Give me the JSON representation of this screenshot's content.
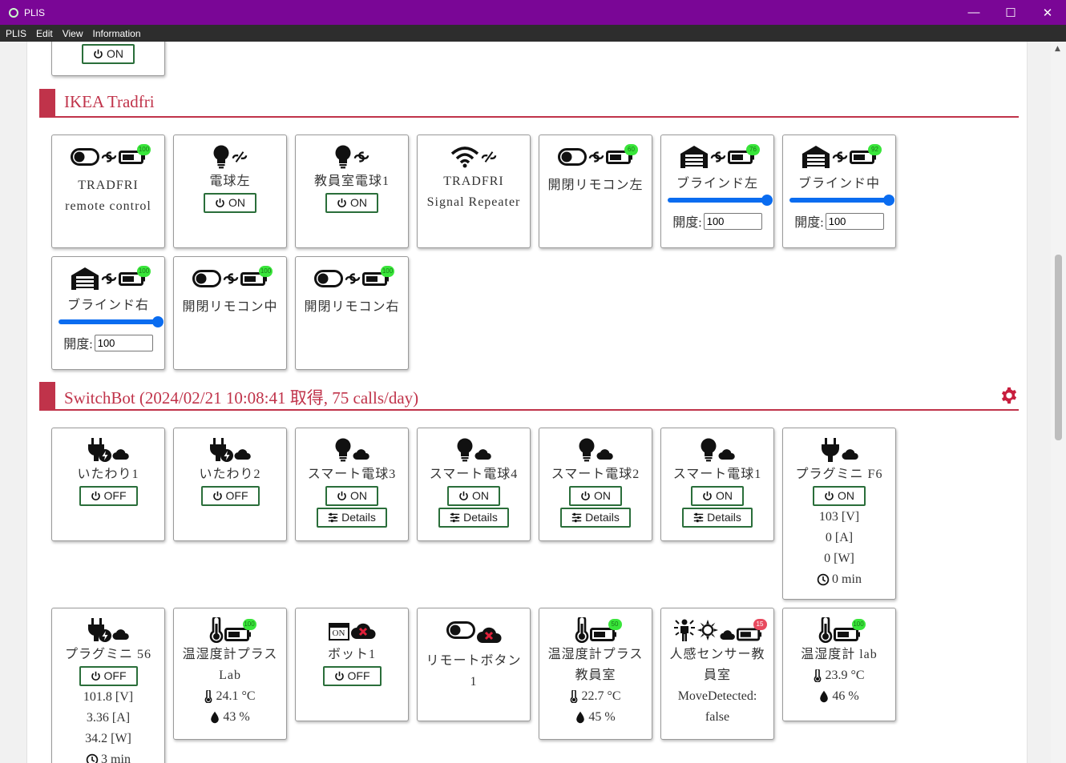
{
  "window": {
    "title": "PLIS",
    "minimize": "—",
    "maximize": "☐",
    "close": "✕"
  },
  "menu": [
    "PLIS",
    "Edit",
    "View",
    "Information"
  ],
  "top_card": {
    "button": "ON"
  },
  "sections": {
    "ikea": {
      "title": "IKEA Tradfri"
    },
    "switchbot": {
      "title": "SwitchBot (2024/02/21 10:08:41 取得, 75 calls/day)"
    }
  },
  "ikea_devices": [
    {
      "label1": "TRADFRI",
      "label2": "remote control",
      "battery": "100"
    },
    {
      "label1": "電球左",
      "button": "ON"
    },
    {
      "label1": "教員室電球1",
      "button": "ON"
    },
    {
      "label1": "TRADFRI",
      "label2": "Signal Repeater"
    },
    {
      "label1": "開閉リモコン左",
      "battery": "60"
    },
    {
      "label1": "ブラインド左",
      "battery": "76",
      "opening_label": "開度:",
      "opening": "100",
      "level": 100
    },
    {
      "label1": "ブラインド中",
      "battery": "92",
      "opening_label": "開度:",
      "opening": "100",
      "level": 100
    },
    {
      "label1": "ブラインド右",
      "battery": "100",
      "opening_label": "開度:",
      "opening": "100",
      "level": 100
    },
    {
      "label1": "開閉リモコン中",
      "battery": "100"
    },
    {
      "label1": "開閉リモコン右",
      "battery": "100"
    }
  ],
  "switchbot_devices": [
    {
      "label1": "いたわり1",
      "button": "OFF"
    },
    {
      "label1": "いたわり2",
      "button": "OFF"
    },
    {
      "label1": "スマート電球3",
      "button": "ON",
      "details": "Details"
    },
    {
      "label1": "スマート電球4",
      "button": "ON",
      "details": "Details"
    },
    {
      "label1": "スマート電球2",
      "button": "ON",
      "details": "Details"
    },
    {
      "label1": "スマート電球1",
      "button": "ON",
      "details": "Details"
    },
    {
      "label1": "プラグミニ F6",
      "button": "ON",
      "voltage": "103 [V]",
      "current": "0 [A]",
      "power": "0 [W]",
      "time": "0 min"
    },
    {
      "label1": "プラグミニ 56",
      "button": "OFF",
      "voltage": "101.8 [V]",
      "current": "3.36 [A]",
      "power": "34.2 [W]",
      "time": "3 min"
    },
    {
      "label1": "温湿度計プラス",
      "label2": "Lab",
      "battery": "100",
      "temp": "24.1 °C",
      "humidity": "43 %"
    },
    {
      "label1": "ボット1",
      "button": "OFF",
      "bot_text": "ON"
    },
    {
      "label1": "リモートボタン",
      "label2": "1"
    },
    {
      "label1": "温湿度計プラス",
      "label2": "教員室",
      "battery": "50",
      "temp": "22.7 °C",
      "humidity": "45 %"
    },
    {
      "label1": "人感センサー教",
      "label2": "員室",
      "label3": "MoveDetected:",
      "label4": "false",
      "battery": "15"
    },
    {
      "label1": "温湿度計 lab",
      "battery": "100",
      "temp": "23.9 °C",
      "humidity": "46 %"
    }
  ]
}
